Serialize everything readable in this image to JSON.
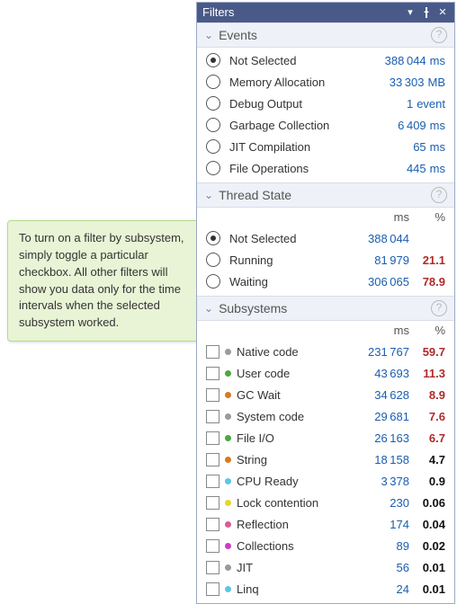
{
  "callout": {
    "text": "To turn on a filter by subsystem, simply toggle a particular checkbox. All other filters will show you data only for the time intervals when the selected subsystem worked."
  },
  "panel": {
    "title": "Filters"
  },
  "events": {
    "title": "Events",
    "items": [
      {
        "label": "Not Selected",
        "value": "388 044",
        "unit": "ms",
        "selected": true
      },
      {
        "label": "Memory Allocation",
        "value": "33 303",
        "unit": "MB",
        "selected": false
      },
      {
        "label": "Debug Output",
        "value": "1",
        "unit": "event",
        "selected": false
      },
      {
        "label": "Garbage Collection",
        "value": "6 409",
        "unit": "ms",
        "selected": false
      },
      {
        "label": "JIT Compilation",
        "value": "65",
        "unit": "ms",
        "selected": false
      },
      {
        "label": "File Operations",
        "value": "445",
        "unit": "ms",
        "selected": false
      }
    ]
  },
  "threadState": {
    "title": "Thread State",
    "header": {
      "ms": "ms",
      "pct": "%"
    },
    "items": [
      {
        "label": "Not Selected",
        "ms": "388 044",
        "pct": "",
        "selected": true
      },
      {
        "label": "Running",
        "ms": "81 979",
        "pct": "21.1",
        "selected": false
      },
      {
        "label": "Waiting",
        "ms": "306 065",
        "pct": "78.9",
        "selected": false
      }
    ]
  },
  "subsystems": {
    "title": "Subsystems",
    "header": {
      "ms": "ms",
      "pct": "%"
    },
    "items": [
      {
        "label": "Native code",
        "ms": "231 767",
        "pct": "59.7",
        "dot": "gray",
        "pctRed": true
      },
      {
        "label": "User code",
        "ms": "43 693",
        "pct": "11.3",
        "dot": "green",
        "pctRed": true
      },
      {
        "label": "GC Wait",
        "ms": "34 628",
        "pct": "8.9",
        "dot": "orange",
        "pctRed": true
      },
      {
        "label": "System code",
        "ms": "29 681",
        "pct": "7.6",
        "dot": "gray",
        "pctRed": true
      },
      {
        "label": "File I/O",
        "ms": "26 163",
        "pct": "6.7",
        "dot": "green",
        "pctRed": true
      },
      {
        "label": "String",
        "ms": "18 158",
        "pct": "4.7",
        "dot": "orange",
        "pctRed": false
      },
      {
        "label": "CPU Ready",
        "ms": "3 378",
        "pct": "0.9",
        "dot": "blue",
        "pctRed": false
      },
      {
        "label": "Lock contention",
        "ms": "230",
        "pct": "0.06",
        "dot": "yellow",
        "pctRed": false
      },
      {
        "label": "Reflection",
        "ms": "174",
        "pct": "0.04",
        "dot": "pink",
        "pctRed": false
      },
      {
        "label": "Collections",
        "ms": "89",
        "pct": "0.02",
        "dot": "magenta",
        "pctRed": false
      },
      {
        "label": "JIT",
        "ms": "56",
        "pct": "0.01",
        "dot": "gray",
        "pctRed": false
      },
      {
        "label": "Linq",
        "ms": "24",
        "pct": "0.01",
        "dot": "blue",
        "pctRed": false
      }
    ]
  }
}
